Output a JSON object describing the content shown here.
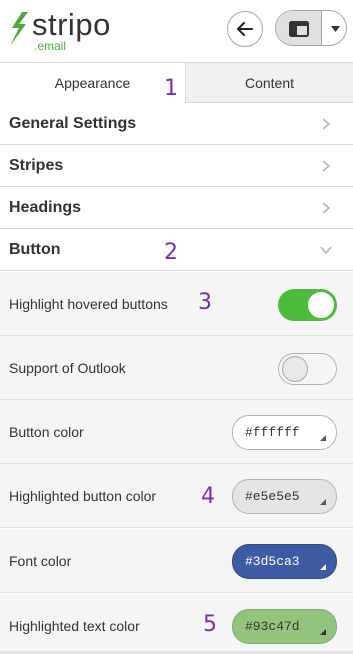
{
  "header": {
    "logo_text": "stripo",
    "logo_sub": ".email",
    "back_icon": "arrow-left-icon",
    "view_icon": "layout-panel-icon",
    "dropdown_icon": "caret-down-icon"
  },
  "tabs": [
    {
      "label": "Appearance",
      "active": true
    },
    {
      "label": "Content",
      "active": false
    }
  ],
  "sections": [
    {
      "label": "General Settings",
      "expanded": false
    },
    {
      "label": "Stripes",
      "expanded": false
    },
    {
      "label": "Headings",
      "expanded": false
    },
    {
      "label": "Button",
      "expanded": true
    }
  ],
  "button_settings": {
    "highlight_hovered": {
      "label": "Highlight hovered buttons",
      "enabled": true
    },
    "support_outlook": {
      "label": "Support of Outlook",
      "enabled": false
    },
    "button_color": {
      "label": "Button color",
      "value": "#ffffff"
    },
    "highlighted_button_color": {
      "label": "Highlighted button color",
      "value": "#e5e5e5"
    },
    "font_color": {
      "label": "Font color",
      "value": "#3d5ca3"
    },
    "highlighted_text_color": {
      "label": "Highlighted text color",
      "value": "#93c47d"
    }
  },
  "annotations": [
    "1",
    "2",
    "3",
    "4",
    "5"
  ],
  "colors": {
    "brand_green": "#4ea93c",
    "toggle_on": "#4dbb3c",
    "annotation_purple": "#7b2fb0"
  }
}
